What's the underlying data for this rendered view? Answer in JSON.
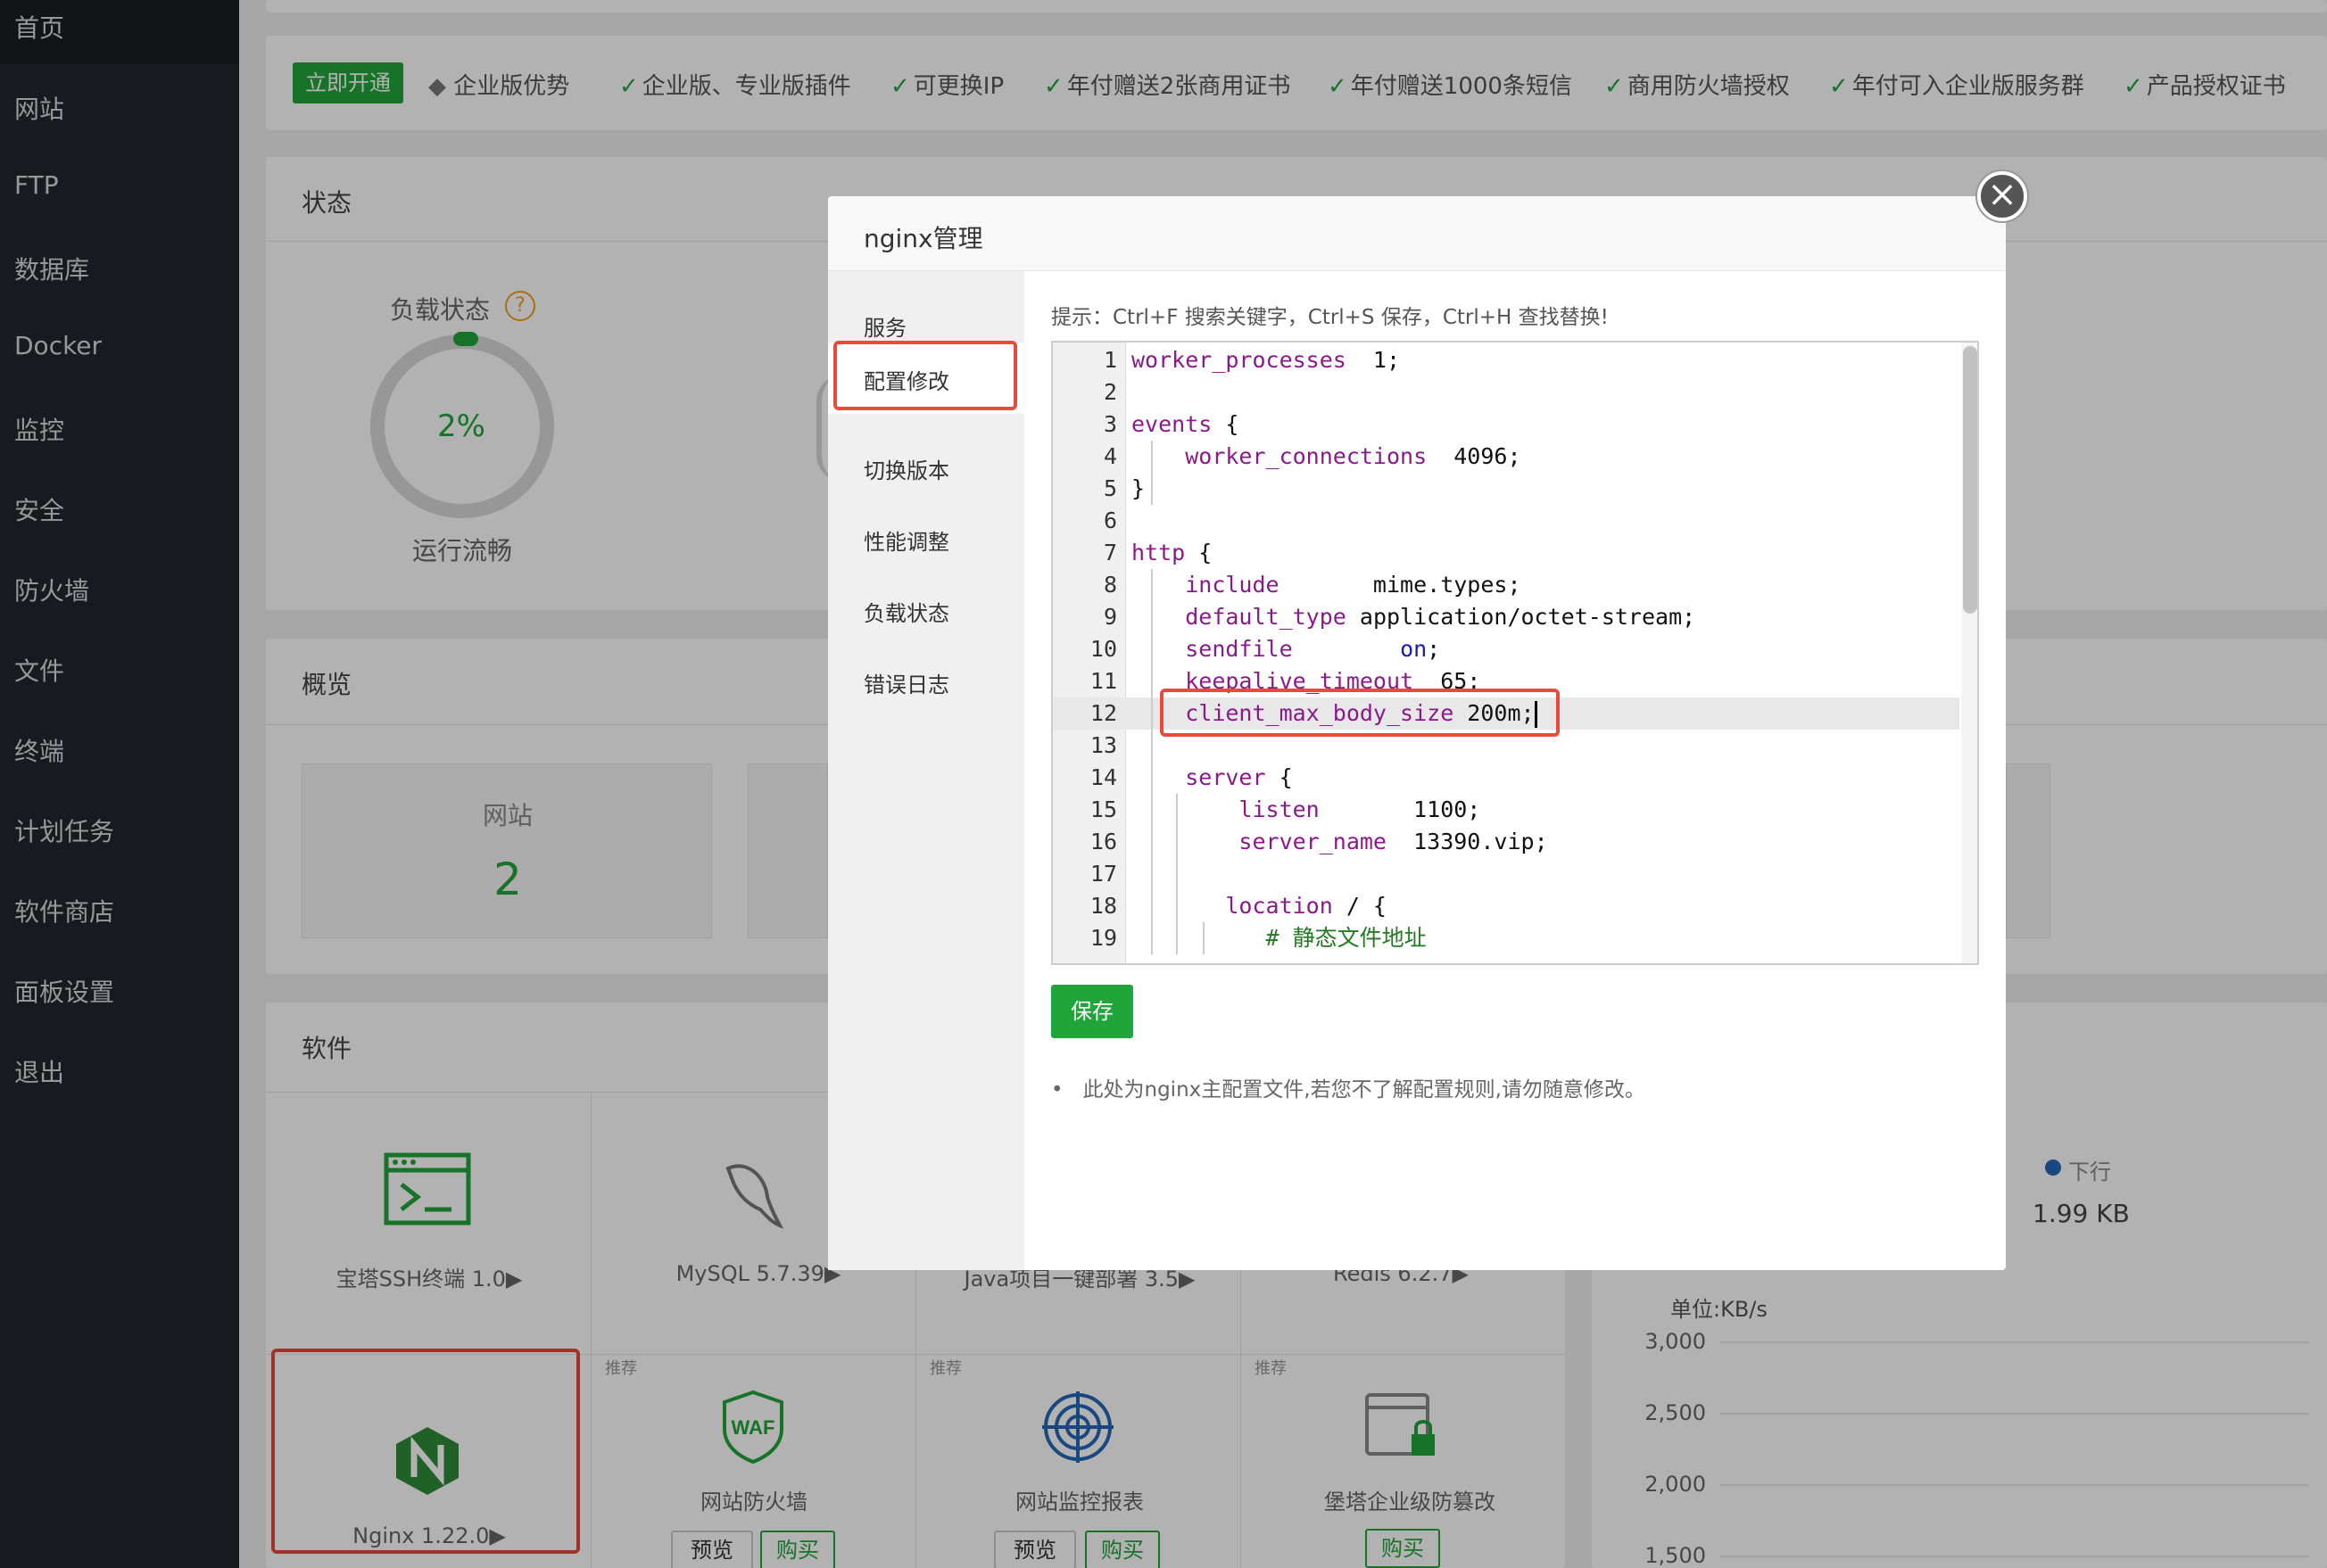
{
  "sidebar": {
    "items": [
      "首页",
      "网站",
      "FTP",
      "数据库",
      "Docker",
      "监控",
      "安全",
      "防火墙",
      "文件",
      "终端",
      "计划任务",
      "软件商店",
      "面板设置",
      "退出"
    ]
  },
  "adbar": {
    "badge": "立即开通",
    "items": [
      "企业版优势",
      "企业版、专业版插件",
      "可更换IP",
      "年付赠送2张商用证书",
      "年付赠送1000条短信",
      "商用防火墙授权",
      "年付可入企业版服务群",
      "产品授权证书"
    ]
  },
  "status": {
    "title": "状态",
    "load_label": "负载状态",
    "help": "?",
    "percent": "2%",
    "run_state": "运行流畅"
  },
  "overview": {
    "title": "概览",
    "site_label": "网站",
    "site_count": "2"
  },
  "software": {
    "title": "软件",
    "row1": [
      "宝塔SSH终端 1.0▶",
      "MySQL 5.7.39▶",
      "Java项目一键部署 3.5▶",
      "Redis 6.2.7▶"
    ],
    "recommend": "推荐",
    "row2": [
      "Nginx 1.22.0▶",
      "网站防火墙",
      "网站监控报表",
      "堡塔企业级防篡改"
    ],
    "btn_preview": "预览",
    "btn_buy": "购买",
    "waf_text": "WAF"
  },
  "traffic": {
    "down_label": "下行",
    "down_value": "1.99 KB",
    "unit": "单位:KB/s",
    "y_ticks": [
      "3,000",
      "2,500",
      "2,000",
      "1,500"
    ]
  },
  "modal": {
    "title": "nginx管理",
    "close": "×",
    "nav": [
      "服务",
      "配置修改",
      "切换版本",
      "性能调整",
      "负载状态",
      "错误日志"
    ],
    "tip": "提示：Ctrl+F 搜索关键字，Ctrl+S 保存，Ctrl+H 查找替换!",
    "save": "保存",
    "note": "此处为nginx主配置文件,若您不了解配置规则,请勿随意修改。"
  },
  "editor": {
    "lines": [
      {
        "n": "1",
        "t": [
          [
            "kw",
            "worker_processes"
          ],
          [
            "",
            "  1;"
          ]
        ]
      },
      {
        "n": "2",
        "t": []
      },
      {
        "n": "3",
        "t": [
          [
            "kw",
            "events"
          ],
          [
            "",
            " {"
          ]
        ]
      },
      {
        "n": "4",
        "t": [
          [
            "",
            "    "
          ],
          [
            "kw",
            "worker_connections"
          ],
          [
            "",
            "  4096;"
          ]
        ]
      },
      {
        "n": "5",
        "t": [
          [
            "",
            "}"
          ]
        ]
      },
      {
        "n": "6",
        "t": []
      },
      {
        "n": "7",
        "t": [
          [
            "kw",
            "http"
          ],
          [
            "",
            " {"
          ]
        ]
      },
      {
        "n": "8",
        "t": [
          [
            "",
            "    "
          ],
          [
            "kw",
            "include"
          ],
          [
            "",
            "       mime.types;"
          ]
        ]
      },
      {
        "n": "9",
        "t": [
          [
            "",
            "    "
          ],
          [
            "kw",
            "default_type"
          ],
          [
            "",
            " application/octet-stream;"
          ]
        ]
      },
      {
        "n": "10",
        "t": [
          [
            "",
            "    "
          ],
          [
            "kw",
            "sendfile"
          ],
          [
            "",
            "        "
          ],
          [
            "val",
            "on"
          ],
          [
            "",
            ";"
          ]
        ]
      },
      {
        "n": "11",
        "t": [
          [
            "",
            "    "
          ],
          [
            "kw",
            "keepalive_timeout"
          ],
          [
            "",
            "  65;"
          ]
        ]
      },
      {
        "n": "12",
        "t": [
          [
            "",
            "    "
          ],
          [
            "kw",
            "client_max_body_size"
          ],
          [
            "",
            " 200m;"
          ]
        ]
      },
      {
        "n": "13",
        "t": []
      },
      {
        "n": "14",
        "t": [
          [
            "",
            "    "
          ],
          [
            "kw",
            "server"
          ],
          [
            "",
            " {"
          ]
        ]
      },
      {
        "n": "15",
        "t": [
          [
            "",
            "        "
          ],
          [
            "kw",
            "listen"
          ],
          [
            "",
            "       1100;"
          ]
        ]
      },
      {
        "n": "16",
        "t": [
          [
            "",
            "        "
          ],
          [
            "kw",
            "server_name"
          ],
          [
            "",
            "  13390.vip;"
          ]
        ]
      },
      {
        "n": "17",
        "t": []
      },
      {
        "n": "18",
        "t": [
          [
            "",
            "       "
          ],
          [
            "kw",
            "location"
          ],
          [
            "",
            " / {"
          ]
        ]
      },
      {
        "n": "19",
        "t": [
          [
            "",
            "          "
          ],
          [
            "cmt",
            "# 静态文件地址"
          ]
        ]
      }
    ]
  }
}
